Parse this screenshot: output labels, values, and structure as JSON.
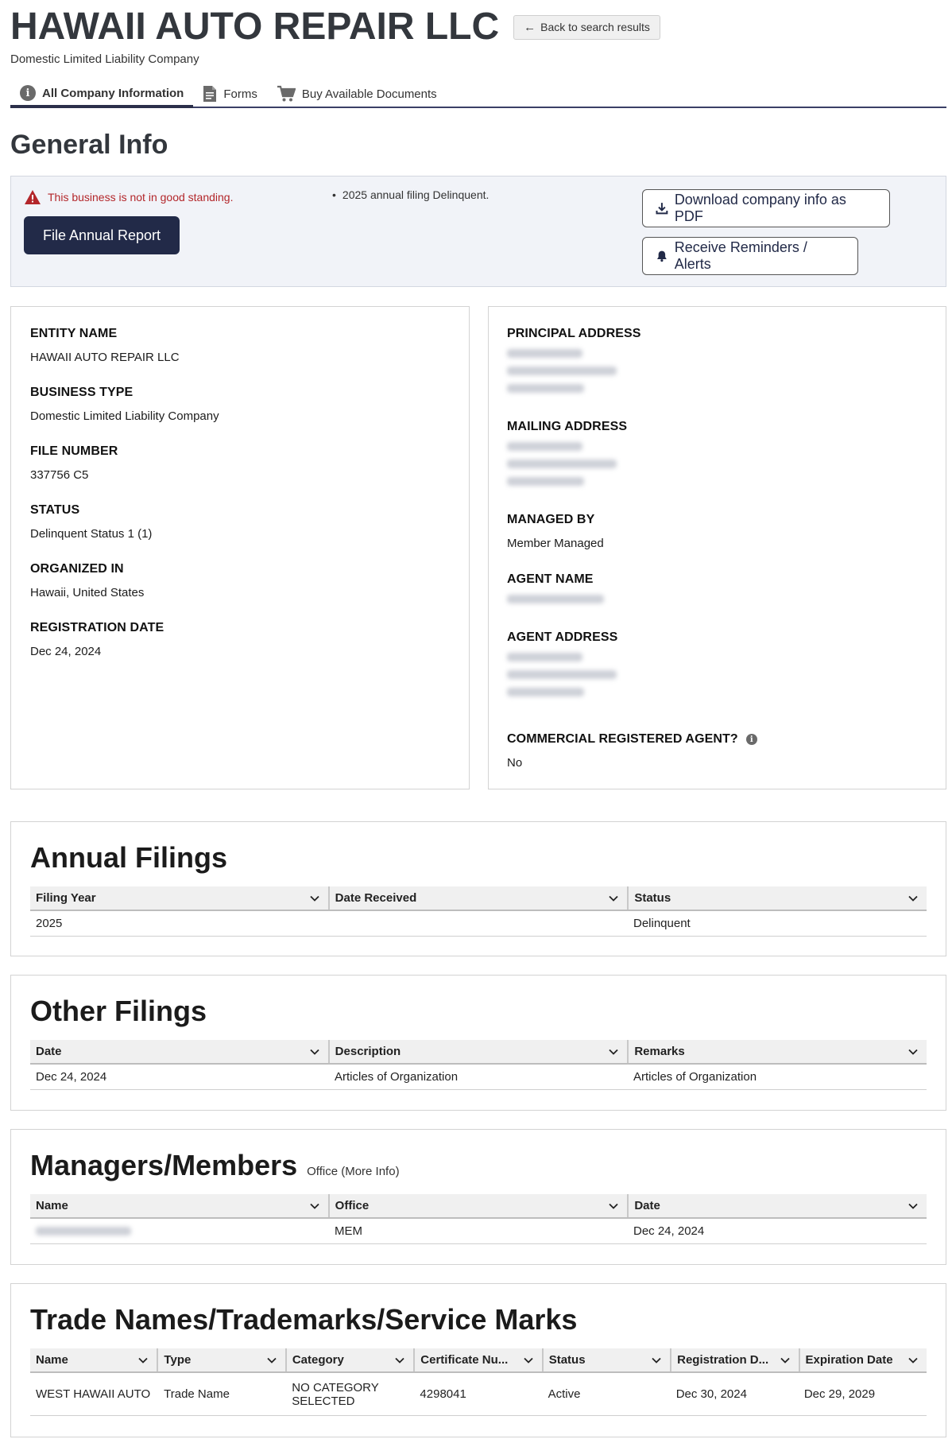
{
  "header": {
    "company_name": "HAWAII AUTO REPAIR LLC",
    "back_button": "Back to search results",
    "company_type": "Domestic Limited Liability Company"
  },
  "tabs": [
    {
      "label": "All Company Information",
      "icon": "info-icon",
      "active": true
    },
    {
      "label": "Forms",
      "icon": "document-icon",
      "active": false
    },
    {
      "label": "Buy Available Documents",
      "icon": "cart-icon",
      "active": false
    }
  ],
  "general": {
    "title": "General Info",
    "alert_text": "This business is not in good standing.",
    "file_button": "File Annual Report",
    "delinquent_note": "2025 annual filing Delinquent.",
    "download_button": "Download company info as PDF",
    "reminders_button": "Receive Reminders / Alerts"
  },
  "left_fields": [
    {
      "label": "ENTITY NAME",
      "value": "HAWAII AUTO REPAIR LLC"
    },
    {
      "label": "BUSINESS TYPE",
      "value": "Domestic Limited Liability Company"
    },
    {
      "label": "FILE NUMBER",
      "value": "337756 C5"
    },
    {
      "label": "STATUS",
      "value": "Delinquent Status 1 (1)"
    },
    {
      "label": "ORGANIZED IN",
      "value": "Hawaii, United States"
    },
    {
      "label": "REGISTRATION DATE",
      "value": "Dec 24, 2024"
    }
  ],
  "right_fields": {
    "principal_address": "PRINCIPAL ADDRESS",
    "mailing_address": "MAILING ADDRESS",
    "managed_by_label": "MANAGED BY",
    "managed_by_value": "Member Managed",
    "agent_name": "AGENT NAME",
    "agent_address": "AGENT ADDRESS",
    "commercial_agent_label": "COMMERCIAL REGISTERED AGENT?",
    "commercial_agent_value": "No"
  },
  "annual_filings": {
    "title": "Annual Filings",
    "headers": [
      "Filing Year",
      "Date Received",
      "Status"
    ],
    "rows": [
      [
        "2025",
        "",
        "Delinquent"
      ]
    ]
  },
  "other_filings": {
    "title": "Other Filings",
    "headers": [
      "Date",
      "Description",
      "Remarks"
    ],
    "rows": [
      [
        "Dec 24, 2024",
        "Articles of Organization",
        "Articles of Organization"
      ]
    ]
  },
  "managers": {
    "title": "Managers/Members",
    "note": "Office (More Info)",
    "headers": [
      "Name",
      "Office",
      "Date"
    ],
    "rows": [
      [
        "",
        "MEM",
        "Dec 24, 2024"
      ]
    ]
  },
  "trade_names": {
    "title": "Trade Names/Trademarks/Service Marks",
    "headers": [
      "Name",
      "Type",
      "Category",
      "Certificate Nu...",
      "Status",
      "Registration D...",
      "Expiration Date"
    ],
    "rows": [
      [
        "WEST HAWAII AUTO",
        "Trade Name",
        "NO CATEGORY SELECTED",
        "4298041",
        "Active",
        "Dec 30, 2024",
        "Dec 29, 2029"
      ]
    ]
  },
  "colors": {
    "title_gray": "#33373d",
    "navy_button": "#222a48",
    "alert_red": "#b3262a",
    "panel_bg": "#f1f3f8"
  }
}
